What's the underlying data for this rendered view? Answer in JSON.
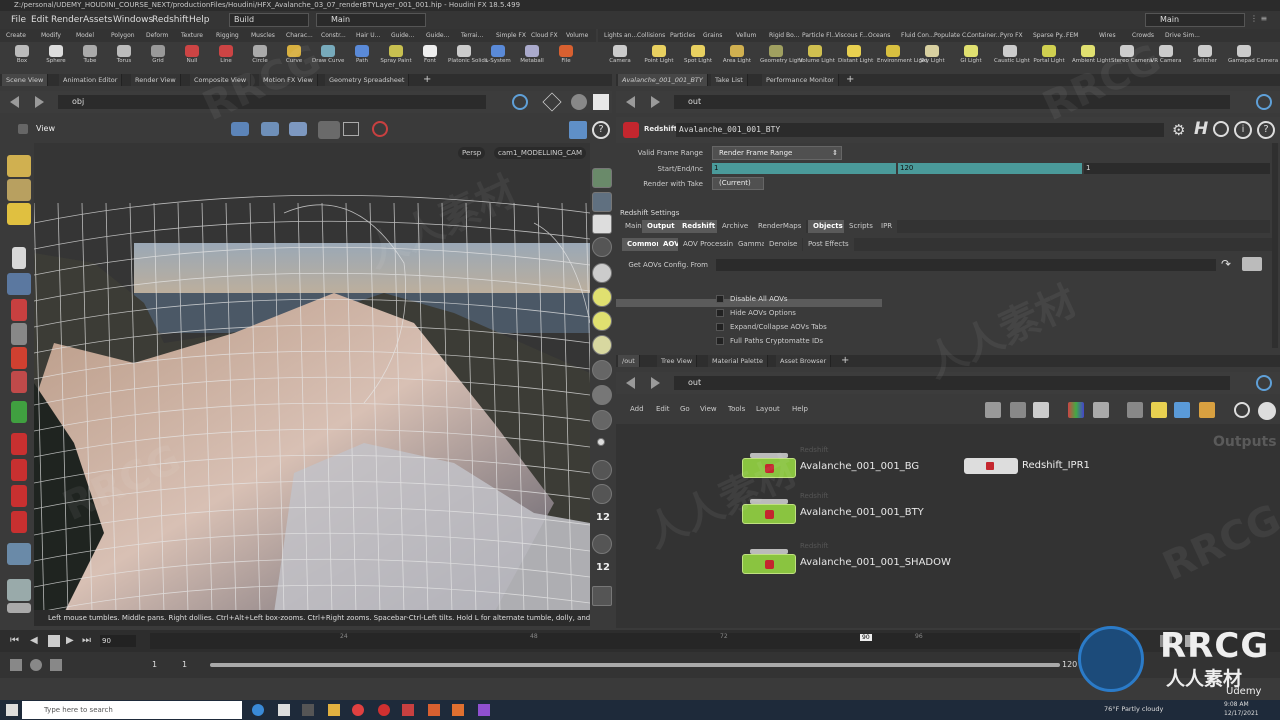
{
  "window": {
    "title": "Z:/personal/UDEMY_HOUDINI_COURSE_NEXT/productionFiles/Houdini/HFX_Avalanche_03_07_renderBTYLayer_001_001.hip - Houdini FX 18.5.499"
  },
  "menu": {
    "items": [
      "File",
      "Edit",
      "Render",
      "Assets",
      "Windows",
      "Redshift",
      "Help"
    ],
    "build": "Build",
    "desktop": "Main",
    "desktop_right": "Main"
  },
  "shelf_left": {
    "tabs": [
      "Create",
      "Modify",
      "Model",
      "Polygon",
      "Deform",
      "Texture",
      "Rigging",
      "Muscles",
      "Charac...",
      "Constr...",
      "Hair U...",
      "Guide...",
      "Guide...",
      "Terrai...",
      "Simple FX",
      "Cloud FX",
      "Volume"
    ],
    "tools": [
      "Box",
      "Sphere",
      "Tube",
      "Torus",
      "Grid",
      "Null",
      "Line",
      "Circle",
      "Curve",
      "Draw Curve",
      "Path",
      "Spray Paint",
      "Font",
      "Platonic Solids",
      "L-System",
      "Metaball",
      "File"
    ]
  },
  "shelf_right": {
    "tabs": [
      "Lights an...",
      "Collisions",
      "Particles",
      "Grains",
      "Vellum",
      "Rigid Bo...",
      "Particle Fl...",
      "Viscous F...",
      "Oceans",
      "Fluid Con...",
      "Populate C...",
      "Container...",
      "Pyro FX",
      "Sparse Py...",
      "FEM",
      "Wires",
      "Crowds",
      "Drive Sim..."
    ],
    "tools": [
      "Camera",
      "Point Light",
      "Spot Light",
      "Area Light",
      "Geometry Light",
      "Volume Light",
      "Distant Light",
      "Environment Light",
      "Sky Light",
      "GI Light",
      "Caustic Light",
      "Portal Light",
      "Ambient Light",
      "Stereo Camera",
      "VR Camera",
      "Switcher",
      "Gamepad Camera"
    ]
  },
  "left_panel": {
    "tabs": [
      "Scene View",
      "Animation Editor",
      "Render View",
      "Composite View",
      "Motion FX View",
      "Geometry Spreadsheet"
    ],
    "path": "obj",
    "view_label": "View",
    "persp": "Persp",
    "camera": "cam1_MODELLING_CAM",
    "hint": "Left mouse tumbles. Middle pans. Right dollies. Ctrl+Alt+Left box-zooms. Ctrl+Right zooms. Spacebar-Ctrl-Left tilts. Hold L for alternate tumble, dolly, and zoom.",
    "side_numbers": [
      "12",
      "12"
    ]
  },
  "params_panel": {
    "tabs": [
      "Avalanche_001_001_BTY",
      "Take List",
      "Performance Monitor"
    ],
    "path": "out",
    "node_type": "Redshift",
    "node_name": "Avalanche_001_001_BTY",
    "frame_range_label": "Valid Frame Range",
    "frame_range_value": "Render Frame Range",
    "start_end_label": "Start/End/Inc",
    "start": "1",
    "end": "120",
    "inc": "1",
    "take_label": "Render with Take",
    "take_value": "(Current)",
    "settings_label": "Redshift Settings",
    "main_tabs": [
      "Main",
      "Output",
      "Redshift",
      "Archive",
      "RenderMaps",
      "Objects",
      "Scripts",
      "IPR"
    ],
    "sub_tabs": [
      "Common",
      "AOV",
      "AOV Processing",
      "Gamma",
      "Denoise",
      "Post Effects"
    ],
    "aov_config_label": "Get AOVs Config. From",
    "checks": [
      "Disable All AOVs",
      "Hide AOVs Options",
      "Expand/Collapse AOVs Tabs",
      "Full Paths Cryptomatte IDs"
    ]
  },
  "network_panel": {
    "tabs": [
      "/out",
      "Tree View",
      "Material Palette",
      "Asset Browser"
    ],
    "path": "out",
    "menu": [
      "Add",
      "Edit",
      "Go",
      "View",
      "Tools",
      "Layout",
      "Help"
    ],
    "context_label": "Outputs",
    "nodes": [
      {
        "tag": "Redshift",
        "name": "Avalanche_001_001_BG"
      },
      {
        "tag": "Redshift",
        "name": "Avalanche_001_001_BTY"
      },
      {
        "tag": "Redshift",
        "name": "Avalanche_001_001_SHADOW"
      }
    ],
    "ipr_node": "Redshift_IPR1"
  },
  "timeline": {
    "current_frame": "90",
    "start": "1",
    "end_start": "1",
    "end": "120",
    "ticks": [
      "24",
      "48",
      "72",
      "90",
      "96"
    ]
  },
  "taskbar": {
    "search_placeholder": "Type here to search",
    "weather": "76°F  Partly cloudy",
    "time": "9:08 AM",
    "date": "12/17/2021"
  },
  "watermark": {
    "text1": "RRCG",
    "text2": "人人素材",
    "brand": "RRCG",
    "brand_sub": "人人素材",
    "udemy": "Udemy"
  },
  "colors": {
    "accent": "#3a8f8f",
    "node_green": "#8ac440",
    "redshift_red": "#c4262e"
  }
}
